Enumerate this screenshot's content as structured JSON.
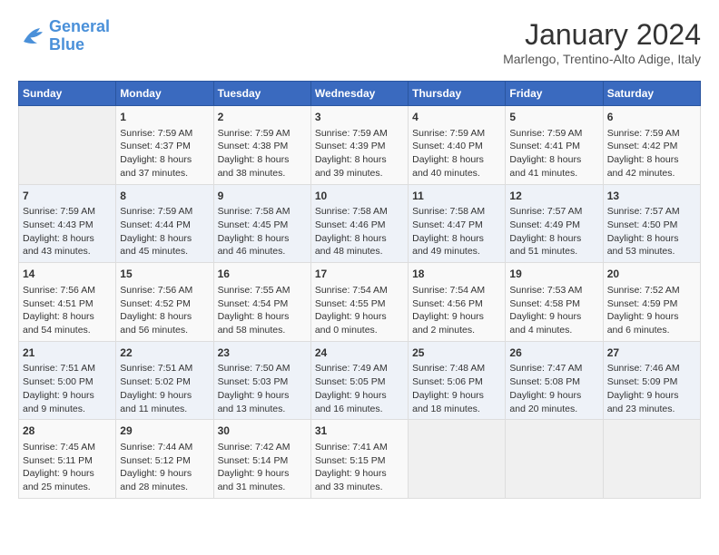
{
  "logo": {
    "line1": "General",
    "line2": "Blue"
  },
  "title": "January 2024",
  "location": "Marlengo, Trentino-Alto Adige, Italy",
  "days_of_week": [
    "Sunday",
    "Monday",
    "Tuesday",
    "Wednesday",
    "Thursday",
    "Friday",
    "Saturday"
  ],
  "weeks": [
    [
      {
        "day": "",
        "info": []
      },
      {
        "day": "1",
        "info": [
          "Sunrise: 7:59 AM",
          "Sunset: 4:37 PM",
          "Daylight: 8 hours",
          "and 37 minutes."
        ]
      },
      {
        "day": "2",
        "info": [
          "Sunrise: 7:59 AM",
          "Sunset: 4:38 PM",
          "Daylight: 8 hours",
          "and 38 minutes."
        ]
      },
      {
        "day": "3",
        "info": [
          "Sunrise: 7:59 AM",
          "Sunset: 4:39 PM",
          "Daylight: 8 hours",
          "and 39 minutes."
        ]
      },
      {
        "day": "4",
        "info": [
          "Sunrise: 7:59 AM",
          "Sunset: 4:40 PM",
          "Daylight: 8 hours",
          "and 40 minutes."
        ]
      },
      {
        "day": "5",
        "info": [
          "Sunrise: 7:59 AM",
          "Sunset: 4:41 PM",
          "Daylight: 8 hours",
          "and 41 minutes."
        ]
      },
      {
        "day": "6",
        "info": [
          "Sunrise: 7:59 AM",
          "Sunset: 4:42 PM",
          "Daylight: 8 hours",
          "and 42 minutes."
        ]
      }
    ],
    [
      {
        "day": "7",
        "info": [
          "Sunrise: 7:59 AM",
          "Sunset: 4:43 PM",
          "Daylight: 8 hours",
          "and 43 minutes."
        ]
      },
      {
        "day": "8",
        "info": [
          "Sunrise: 7:59 AM",
          "Sunset: 4:44 PM",
          "Daylight: 8 hours",
          "and 45 minutes."
        ]
      },
      {
        "day": "9",
        "info": [
          "Sunrise: 7:58 AM",
          "Sunset: 4:45 PM",
          "Daylight: 8 hours",
          "and 46 minutes."
        ]
      },
      {
        "day": "10",
        "info": [
          "Sunrise: 7:58 AM",
          "Sunset: 4:46 PM",
          "Daylight: 8 hours",
          "and 48 minutes."
        ]
      },
      {
        "day": "11",
        "info": [
          "Sunrise: 7:58 AM",
          "Sunset: 4:47 PM",
          "Daylight: 8 hours",
          "and 49 minutes."
        ]
      },
      {
        "day": "12",
        "info": [
          "Sunrise: 7:57 AM",
          "Sunset: 4:49 PM",
          "Daylight: 8 hours",
          "and 51 minutes."
        ]
      },
      {
        "day": "13",
        "info": [
          "Sunrise: 7:57 AM",
          "Sunset: 4:50 PM",
          "Daylight: 8 hours",
          "and 53 minutes."
        ]
      }
    ],
    [
      {
        "day": "14",
        "info": [
          "Sunrise: 7:56 AM",
          "Sunset: 4:51 PM",
          "Daylight: 8 hours",
          "and 54 minutes."
        ]
      },
      {
        "day": "15",
        "info": [
          "Sunrise: 7:56 AM",
          "Sunset: 4:52 PM",
          "Daylight: 8 hours",
          "and 56 minutes."
        ]
      },
      {
        "day": "16",
        "info": [
          "Sunrise: 7:55 AM",
          "Sunset: 4:54 PM",
          "Daylight: 8 hours",
          "and 58 minutes."
        ]
      },
      {
        "day": "17",
        "info": [
          "Sunrise: 7:54 AM",
          "Sunset: 4:55 PM",
          "Daylight: 9 hours",
          "and 0 minutes."
        ]
      },
      {
        "day": "18",
        "info": [
          "Sunrise: 7:54 AM",
          "Sunset: 4:56 PM",
          "Daylight: 9 hours",
          "and 2 minutes."
        ]
      },
      {
        "day": "19",
        "info": [
          "Sunrise: 7:53 AM",
          "Sunset: 4:58 PM",
          "Daylight: 9 hours",
          "and 4 minutes."
        ]
      },
      {
        "day": "20",
        "info": [
          "Sunrise: 7:52 AM",
          "Sunset: 4:59 PM",
          "Daylight: 9 hours",
          "and 6 minutes."
        ]
      }
    ],
    [
      {
        "day": "21",
        "info": [
          "Sunrise: 7:51 AM",
          "Sunset: 5:00 PM",
          "Daylight: 9 hours",
          "and 9 minutes."
        ]
      },
      {
        "day": "22",
        "info": [
          "Sunrise: 7:51 AM",
          "Sunset: 5:02 PM",
          "Daylight: 9 hours",
          "and 11 minutes."
        ]
      },
      {
        "day": "23",
        "info": [
          "Sunrise: 7:50 AM",
          "Sunset: 5:03 PM",
          "Daylight: 9 hours",
          "and 13 minutes."
        ]
      },
      {
        "day": "24",
        "info": [
          "Sunrise: 7:49 AM",
          "Sunset: 5:05 PM",
          "Daylight: 9 hours",
          "and 16 minutes."
        ]
      },
      {
        "day": "25",
        "info": [
          "Sunrise: 7:48 AM",
          "Sunset: 5:06 PM",
          "Daylight: 9 hours",
          "and 18 minutes."
        ]
      },
      {
        "day": "26",
        "info": [
          "Sunrise: 7:47 AM",
          "Sunset: 5:08 PM",
          "Daylight: 9 hours",
          "and 20 minutes."
        ]
      },
      {
        "day": "27",
        "info": [
          "Sunrise: 7:46 AM",
          "Sunset: 5:09 PM",
          "Daylight: 9 hours",
          "and 23 minutes."
        ]
      }
    ],
    [
      {
        "day": "28",
        "info": [
          "Sunrise: 7:45 AM",
          "Sunset: 5:11 PM",
          "Daylight: 9 hours",
          "and 25 minutes."
        ]
      },
      {
        "day": "29",
        "info": [
          "Sunrise: 7:44 AM",
          "Sunset: 5:12 PM",
          "Daylight: 9 hours",
          "and 28 minutes."
        ]
      },
      {
        "day": "30",
        "info": [
          "Sunrise: 7:42 AM",
          "Sunset: 5:14 PM",
          "Daylight: 9 hours",
          "and 31 minutes."
        ]
      },
      {
        "day": "31",
        "info": [
          "Sunrise: 7:41 AM",
          "Sunset: 5:15 PM",
          "Daylight: 9 hours",
          "and 33 minutes."
        ]
      },
      {
        "day": "",
        "info": []
      },
      {
        "day": "",
        "info": []
      },
      {
        "day": "",
        "info": []
      }
    ]
  ]
}
